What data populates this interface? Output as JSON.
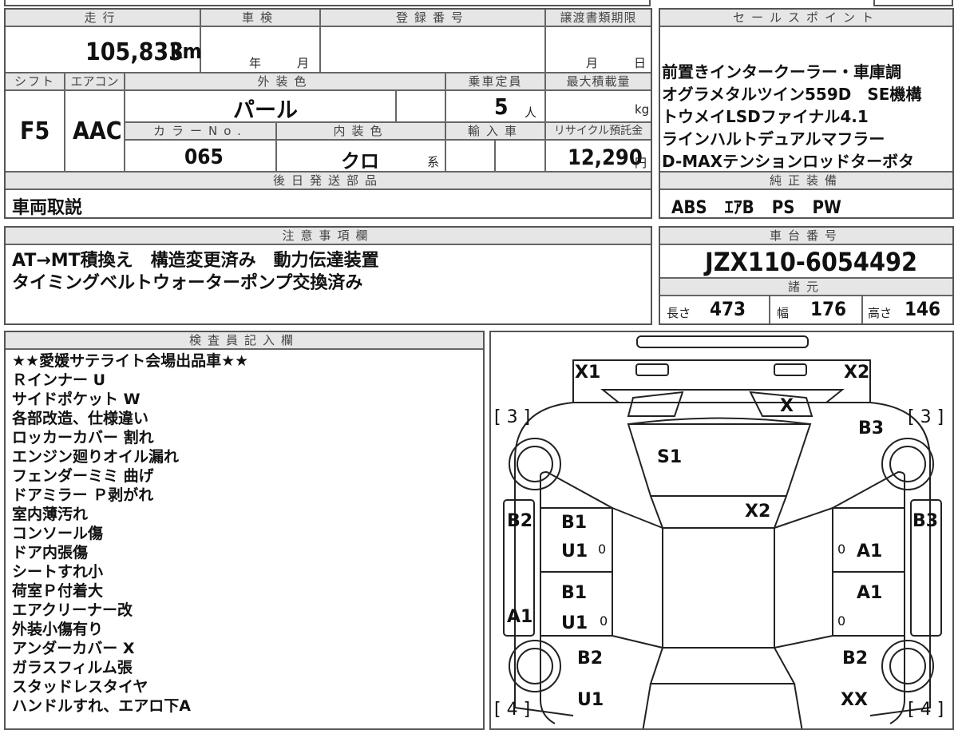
{
  "top": {
    "mileage_label": "走行",
    "mileage_value": "105,833",
    "mileage_unit": "km",
    "shaken_label": "車検",
    "shaken_year": "年",
    "shaken_month": "月",
    "registration_label": "登録番号",
    "transfer_label": "譲渡書類期限",
    "transfer_month": "月",
    "transfer_day": "日"
  },
  "row2": {
    "shift_label": "シフト",
    "shift_value": "F5",
    "ac_label": "エアコン",
    "ac_value": "AAC",
    "exterior_color_label": "外装色",
    "exterior_color_value": "パール",
    "capacity_label": "乗車定員",
    "capacity_value": "5",
    "capacity_unit": "人",
    "max_load_label": "最大積載量",
    "max_load_unit": "kg",
    "color_no_label": "カラーNo.",
    "color_no_value": "065",
    "interior_color_label": "内装色",
    "interior_color_value": "クロ",
    "interior_color_suffix": "系",
    "import_label": "輸入車",
    "recycle_label": "リサイクル預託金",
    "recycle_value": "12,290",
    "recycle_unit": "円"
  },
  "later_parts": {
    "label": "後日発送部品",
    "value": "車両取説"
  },
  "sales_points": {
    "label": "セールスポイント",
    "lines": [
      "前置きインタークーラー・車庫調",
      "オグラメタルツイン559D　SE機構",
      "トウメイLSDファイナル4.1",
      "ラインハルトデュアルマフラー",
      "D-MAXテンションロッドターボタ"
    ]
  },
  "genuine_equipment": {
    "label": "純正装備",
    "value": "ABS　ｴｱB　PS　PW"
  },
  "notes": {
    "label": "注意事項欄",
    "lines": [
      "AT→MT積換え　構造変更済み　動力伝達装置",
      "タイミングベルトウォーターポンプ交換済み"
    ]
  },
  "chassis": {
    "label": "車台番号",
    "value": "JZX110-6054492"
  },
  "specs": {
    "label": "諸元",
    "length_label": "長さ",
    "length_value": "473",
    "width_label": "幅",
    "width_value": "176",
    "height_label": "高さ",
    "height_value": "146"
  },
  "inspector": {
    "label": "検査員記入欄",
    "lines": [
      "★★愛媛サテライト会場出品車★★",
      "Ｒインナー U",
      "サイドポケット W",
      "各部改造、仕様違い",
      "ロッカーカバー 割れ",
      "エンジン廻りオイル漏れ",
      "フェンダーミミ 曲げ",
      "ドアミラー Ｐ剥がれ",
      "室内薄汚れ",
      "コンソール傷",
      "ドア内張傷",
      "シートすれ小",
      "荷室Ｐ付着大",
      "エアクリーナー改",
      "外装小傷有り",
      "アンダーカバー X",
      "ガラスフィルム張",
      "スタッドレスタイヤ",
      "ハンドルすれ、エアロ下A"
    ]
  },
  "diagram": {
    "marks": {
      "front_left": "X1",
      "front_right": "X2",
      "headlight_right": "X",
      "windshield": "S1",
      "roof": "X2",
      "front_fender_left_tag": "[ 3 ]",
      "front_fender_right_tag": "[ 3 ]",
      "front_fender_right": "B3",
      "side_left_b2": "B2",
      "side_right_b3": "B3",
      "front_door_left_b1": "B1",
      "front_door_left_u1": "U1",
      "front_door_left_zero": "0",
      "front_door_right_zero": "0",
      "front_door_right_a1": "A1",
      "rear_door_left_b1": "B1",
      "rear_door_left_u1": "U1",
      "rear_door_left_zero": "0",
      "rear_door_right_a1": "A1",
      "rear_door_right_zero": "0",
      "rocker_left_a1": "A1",
      "rear_fender_left_b2": "B2",
      "rear_fender_right_b2": "B2",
      "rear_left_u1": "U1",
      "rear_right_xx": "XX",
      "rear_left_tag": "[ 4 ]",
      "rear_right_tag": "[ 4 ]"
    }
  }
}
